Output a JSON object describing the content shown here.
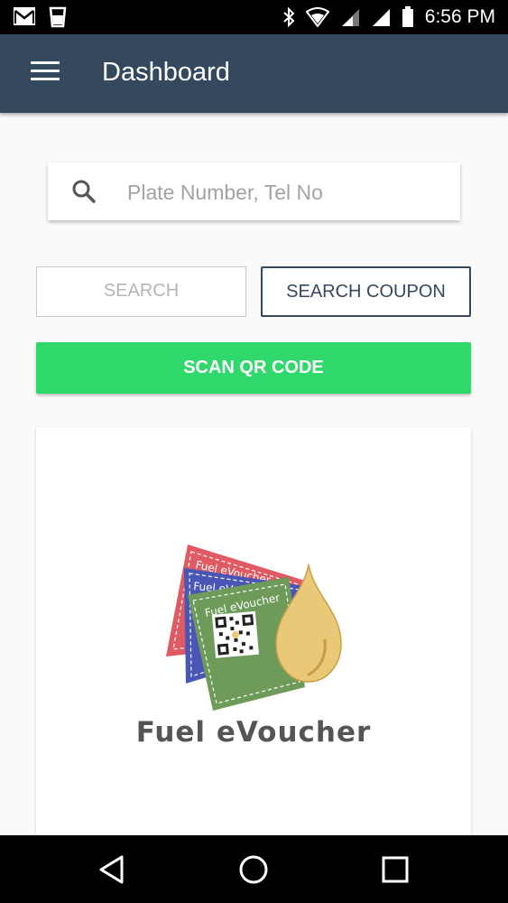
{
  "status_bar": {
    "time": "6:56 PM",
    "icons": [
      "gmail-icon",
      "cup-icon",
      "bluetooth-icon",
      "wifi-icon",
      "signal-icon",
      "signal-icon",
      "battery-icon"
    ]
  },
  "app_bar": {
    "title": "Dashboard",
    "menu_icon": "hamburger-menu-icon"
  },
  "search": {
    "placeholder": "Plate Number, Tel No",
    "value": "",
    "icon": "search-icon"
  },
  "buttons": {
    "search_label": "SEARCH",
    "search_coupon_label": "SEARCH COUPON",
    "scan_qr_label": "SCAN QR CODE"
  },
  "logo": {
    "caption": "Fuel eVoucher",
    "voucher_label": "Fuel eVoucher"
  },
  "nav_bar": {
    "icons": [
      "back-icon",
      "home-icon",
      "recents-icon"
    ]
  },
  "colors": {
    "app_bar": "#34495e",
    "scan_button": "#2ed86b",
    "voucher_red": "#e05a63",
    "voucher_blue": "#4a56b5",
    "voucher_green": "#6e9b5a",
    "drop_gold": "#e9c878"
  }
}
